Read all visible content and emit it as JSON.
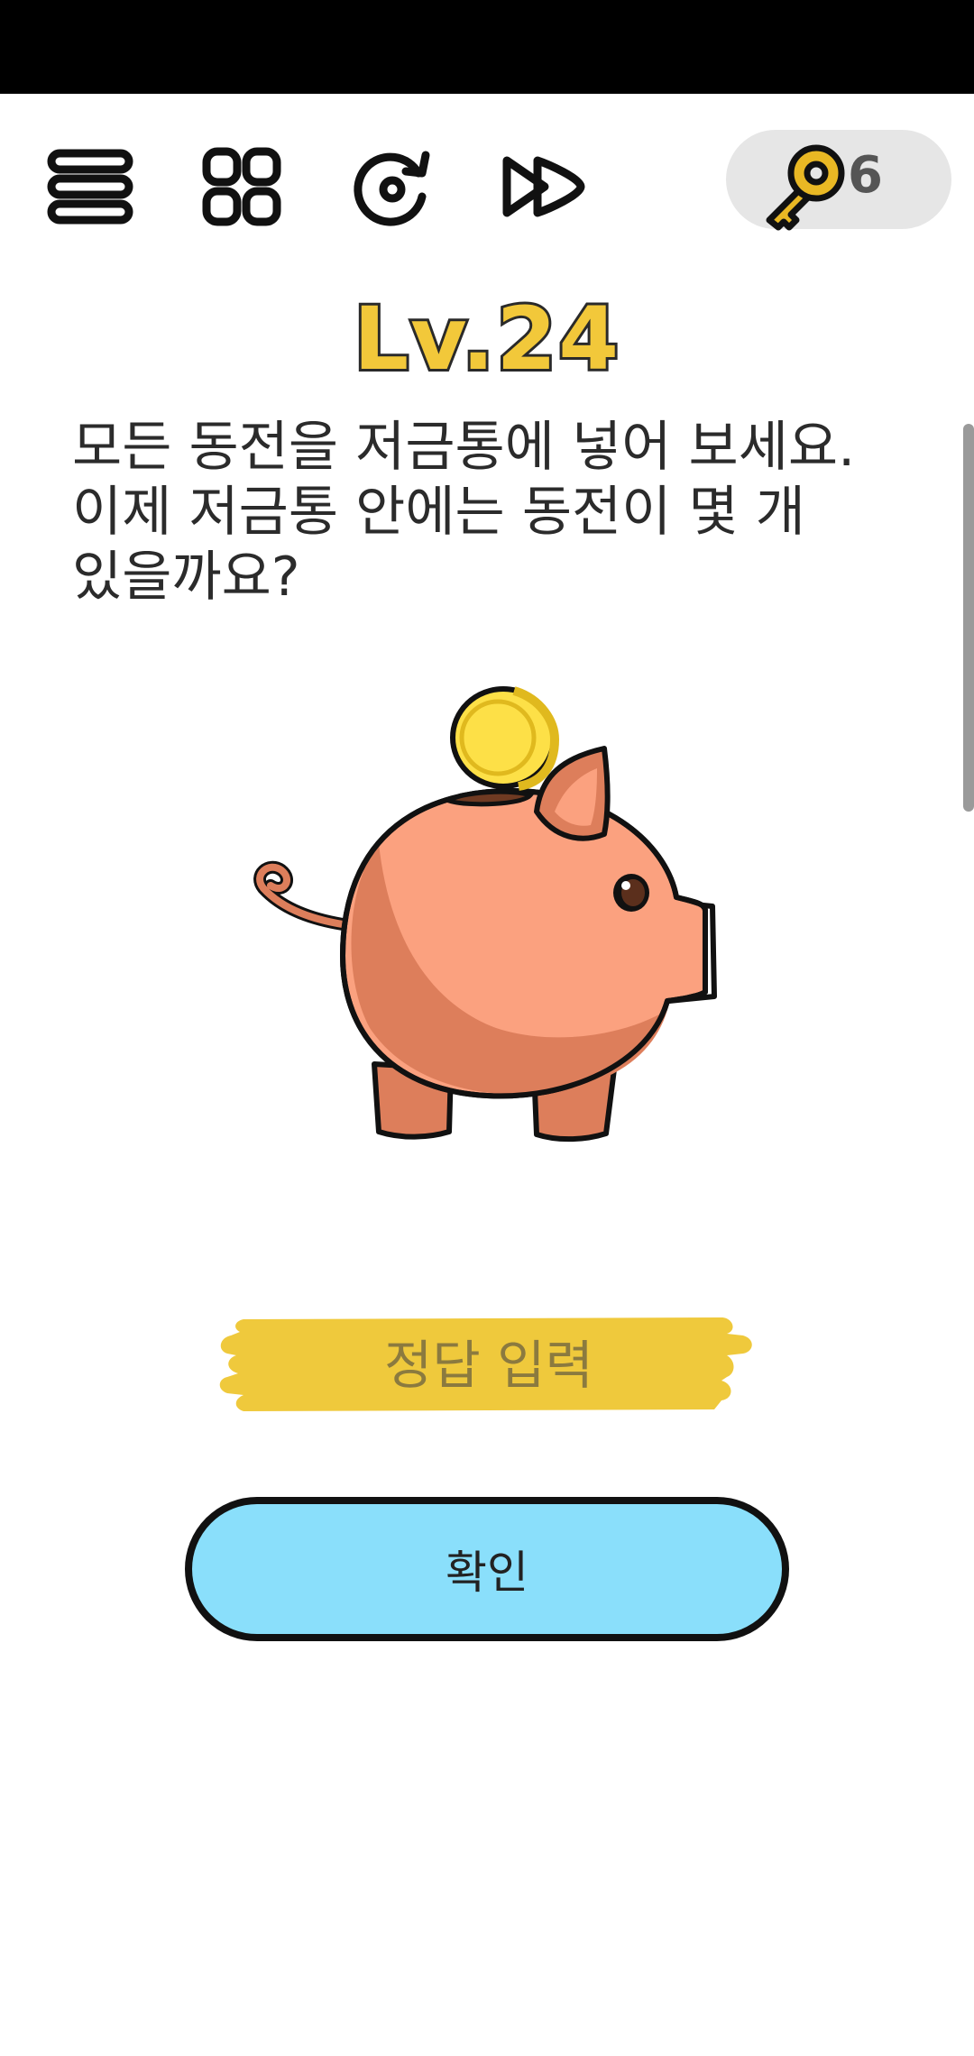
{
  "toolbar": {
    "buttons": [
      {
        "name": "menu",
        "icon": "menu-icon"
      },
      {
        "name": "levels",
        "icon": "grid-icon"
      },
      {
        "name": "restart",
        "icon": "restart-icon"
      },
      {
        "name": "skip",
        "icon": "fast-forward-icon"
      }
    ],
    "keys": {
      "icon": "key-icon",
      "count": "6"
    }
  },
  "level": {
    "title": "Lv.24"
  },
  "question": {
    "line1": "모든 동전을 저금통에 넣어 보세요.",
    "line2": "이제 저금통 안에는 동전이 몇 개",
    "line3": "있을까요?"
  },
  "illustration": {
    "subject": "piggy-bank-with-coin",
    "coin_color": "#fde047",
    "pig_color": "#fba17f"
  },
  "answer": {
    "placeholder": "정답 입력",
    "value": ""
  },
  "confirm": {
    "label": "확인"
  },
  "colors": {
    "accent_yellow": "#f2c83a",
    "button_blue": "#8adffb"
  }
}
